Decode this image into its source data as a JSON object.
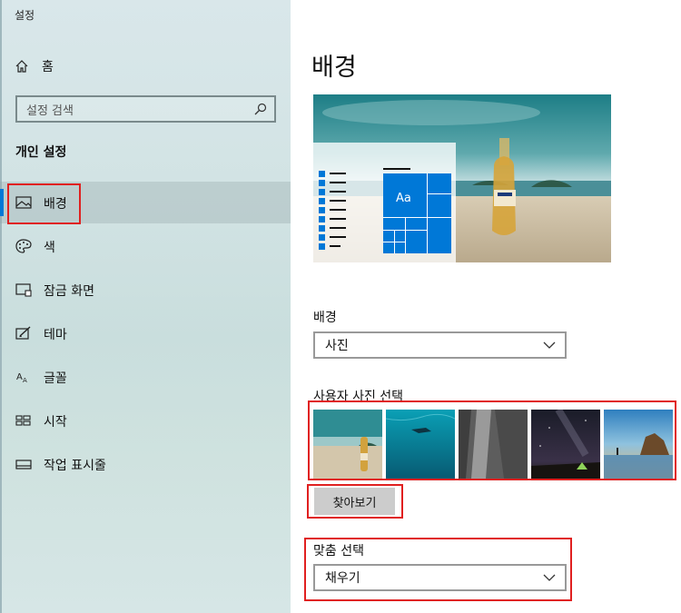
{
  "window": {
    "title": "설정"
  },
  "sidebar": {
    "home_label": "홈",
    "search_placeholder": "설정 검색",
    "section_title": "개인 설정",
    "items": [
      {
        "label": "배경",
        "icon": "picture-icon",
        "selected": true
      },
      {
        "label": "색",
        "icon": "palette-icon"
      },
      {
        "label": "잠금 화면",
        "icon": "lock-screen-icon"
      },
      {
        "label": "테마",
        "icon": "theme-brush-icon"
      },
      {
        "label": "글꼴",
        "icon": "font-icon"
      },
      {
        "label": "시작",
        "icon": "start-tiles-icon"
      },
      {
        "label": "작업 표시줄",
        "icon": "taskbar-icon"
      }
    ]
  },
  "main": {
    "title": "배경",
    "preview": {
      "tile_label": "Aa"
    },
    "background_label": "배경",
    "background_value": "사진",
    "choose_picture_label": "사용자 사진 선택",
    "thumbnails": [
      "beach-bottle",
      "underwater-diver",
      "rock-cliff",
      "night-sky-tent",
      "rocky-coast-sunset"
    ],
    "browse_label": "찾아보기",
    "fit_label": "맞춤 선택",
    "fit_value": "채우기"
  },
  "colors": {
    "accent": "#0078d7",
    "highlight": "#e02020"
  }
}
